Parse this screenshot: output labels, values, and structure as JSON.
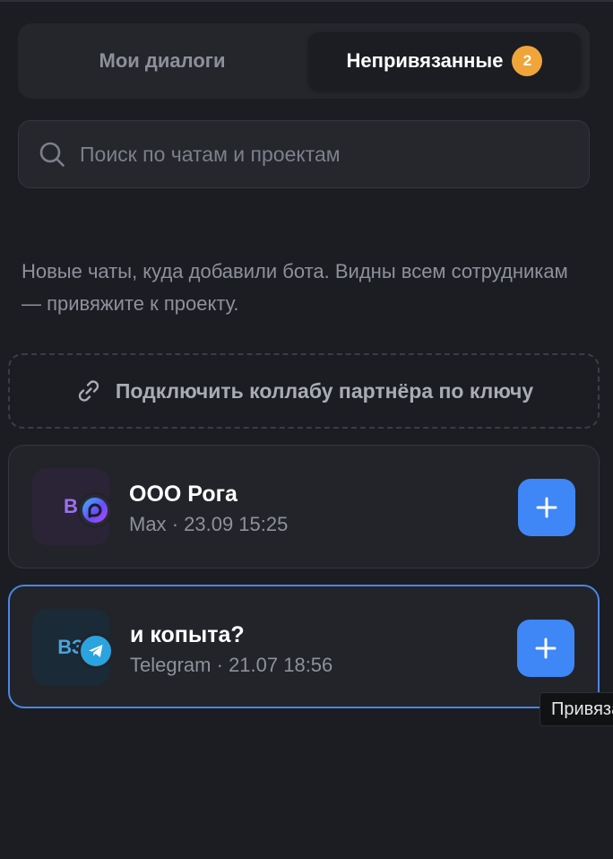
{
  "tabs": {
    "my_dialogs": "Мои диалоги",
    "unbound": "Непривязанные",
    "unbound_count": "2"
  },
  "search": {
    "placeholder": "Поиск по чатам и проектам",
    "value": ""
  },
  "hint": "Новые чаты, куда добавили бота. Видны всем сотрудникам — привяжите к проекту.",
  "connect_button": "Подключить коллабу партнёра по ключу",
  "chats": [
    {
      "avatar_initials": "В",
      "title": "ООО Рога",
      "messenger": "Max",
      "date": "23.09 15:25",
      "messenger_icon": "max-icon"
    },
    {
      "avatar_initials": "ВЗ",
      "title": "и копыта?",
      "messenger": "Telegram",
      "date": "21.07 18:56",
      "messenger_icon": "telegram-icon"
    }
  ],
  "separator": "·",
  "tooltip": "Привязать",
  "colors": {
    "accent": "#3f86f6",
    "badge": "#f0a53a",
    "selected_border": "#4a86e8",
    "telegram": "#2aa3e0"
  }
}
